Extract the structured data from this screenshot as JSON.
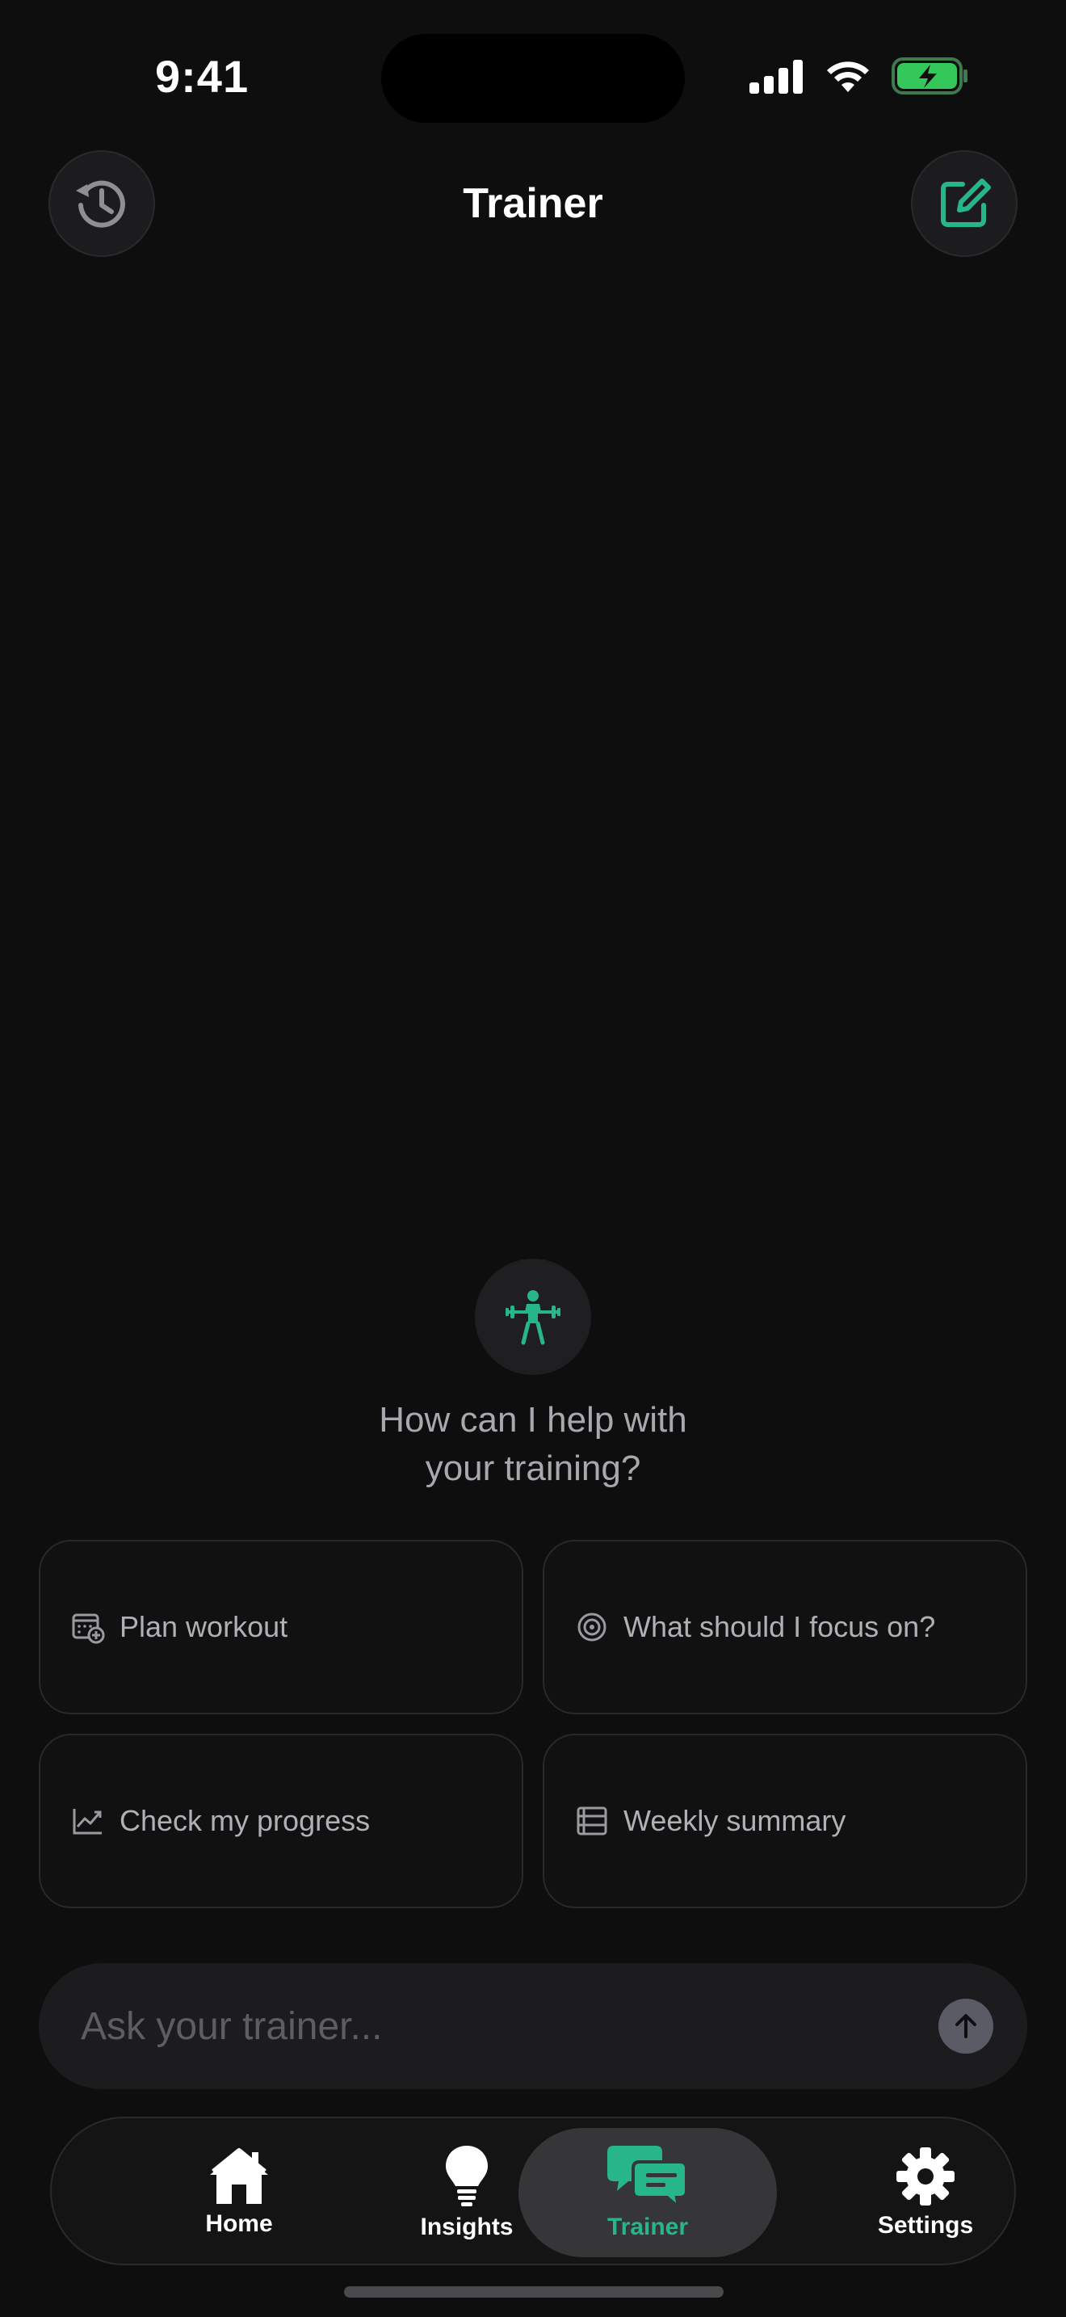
{
  "status_bar": {
    "time": "9:41"
  },
  "header": {
    "title": "Trainer",
    "history_icon": "history-icon",
    "compose_icon": "compose-icon"
  },
  "prompt": {
    "line1": "How can I help with",
    "line2": "your training?",
    "avatar_icon": "weightlifter-icon"
  },
  "suggestions": [
    {
      "label": "Plan workout",
      "icon": "calendar-add-icon"
    },
    {
      "label": "What should I focus on?",
      "icon": "target-icon"
    },
    {
      "label": "Check my progress",
      "icon": "trend-chart-icon"
    },
    {
      "label": "Weekly summary",
      "icon": "list-summary-icon"
    }
  ],
  "composer": {
    "placeholder": "Ask your trainer...",
    "send_icon": "arrow-up-icon"
  },
  "tab_bar": {
    "tabs": [
      {
        "label": "Home",
        "icon": "house-icon",
        "active": false
      },
      {
        "label": "Insights",
        "icon": "lightbulb-icon",
        "active": false
      },
      {
        "label": "Trainer",
        "icon": "chat-bubbles-icon",
        "active": true
      },
      {
        "label": "Settings",
        "icon": "gear-icon",
        "active": false
      }
    ]
  },
  "colors": {
    "background": "#0e0e0f",
    "accent": "#27b58a",
    "battery": "#34c759",
    "secondary_text": "#a8a8ae"
  }
}
